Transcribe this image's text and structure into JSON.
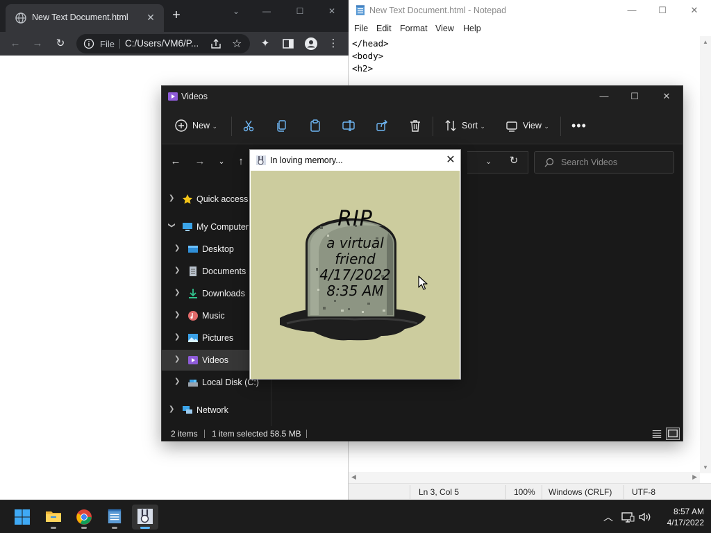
{
  "chrome": {
    "tab_title": "New Text Document.html",
    "url_scheme": "File",
    "url": "C:/Users/VM6/P..."
  },
  "notepad": {
    "title": "New Text Document.html - Notepad",
    "menu": [
      "File",
      "Edit",
      "Format",
      "View",
      "Help"
    ],
    "content": "</head>\n<body>\n<h2>",
    "status": {
      "position": "Ln 3, Col 5",
      "zoom": "100%",
      "line_ending": "Windows (CRLF)",
      "encoding": "UTF-8"
    }
  },
  "explorer": {
    "title": "Videos",
    "commands": {
      "new": "New",
      "sort": "Sort",
      "view": "View"
    },
    "search_placeholder": "Search Videos",
    "nav": [
      {
        "label": "Quick access",
        "icon": "star-icon"
      },
      {
        "label": "My Computer",
        "icon": "computer-icon"
      },
      {
        "label": "Desktop",
        "icon": "desktop-icon"
      },
      {
        "label": "Documents",
        "icon": "documents-icon"
      },
      {
        "label": "Downloads",
        "icon": "downloads-icon"
      },
      {
        "label": "Music",
        "icon": "music-icon"
      },
      {
        "label": "Pictures",
        "icon": "pictures-icon"
      },
      {
        "label": "Videos",
        "icon": "videos-icon",
        "selected": true
      },
      {
        "label": "Local Disk (C:)",
        "icon": "disk-icon"
      },
      {
        "label": "Network",
        "icon": "network-icon"
      }
    ],
    "status": {
      "items": "2 items",
      "selected": "1 item selected",
      "size": "58.5 MB"
    }
  },
  "popup": {
    "title": "In loving memory...",
    "tombstone": {
      "line1": "RIP",
      "line2": "a virtual",
      "line3": "friend",
      "line4": "4/17/2022",
      "line5": "8:35 AM"
    }
  },
  "taskbar": {
    "time": "8:57 AM",
    "date": "4/17/2022"
  },
  "colors": {
    "chrome_dark": "#202124",
    "explorer_bg": "#191919",
    "tombstone_bg": "#cccc9e",
    "taskbar_bg": "#1c1c1c",
    "accent_blue": "#5cb8ff"
  }
}
